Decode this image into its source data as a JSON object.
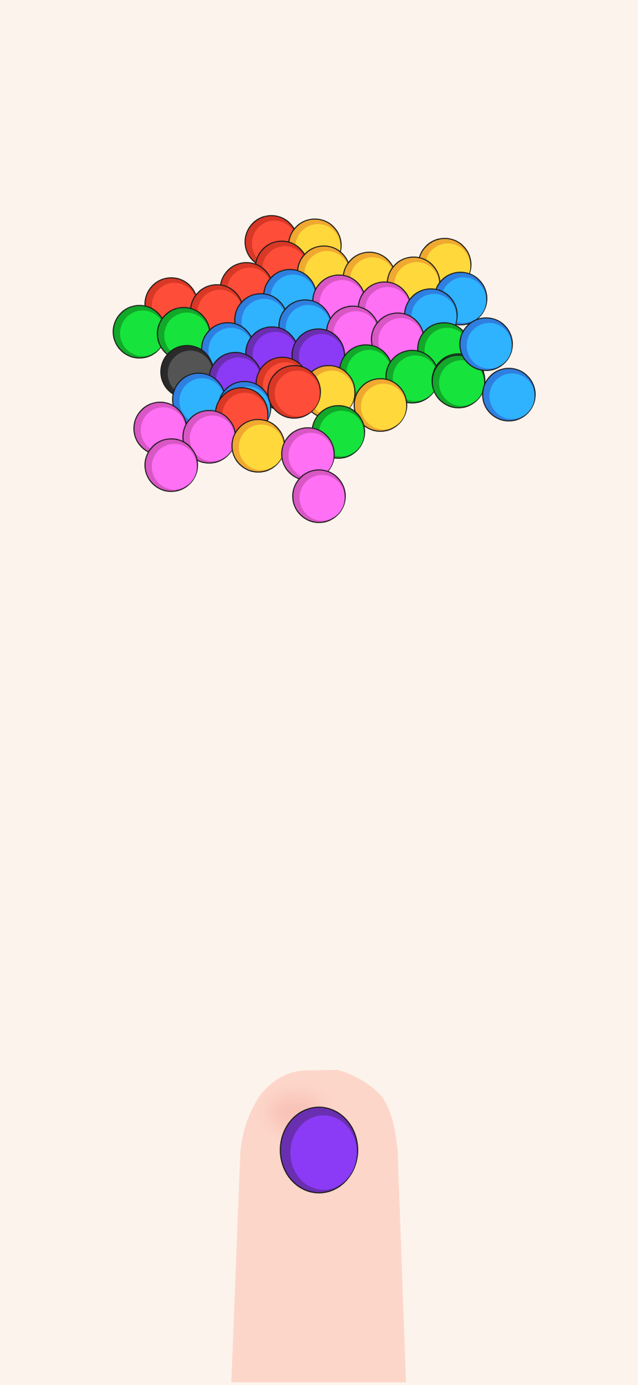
{
  "colors": {
    "background": "#fcf4ec",
    "finger": "#fdd6ca",
    "finger_blush": "#f5b3a8",
    "outline": "#1a1a1a"
  },
  "palette": {
    "red": {
      "base": "#fe4e3a",
      "shade": "#d93826"
    },
    "yellow": {
      "base": "#ffd93b",
      "shade": "#f0a930"
    },
    "blue": {
      "base": "#2fb3ff",
      "shade": "#2f7fe0"
    },
    "pink": {
      "base": "#ff70f5",
      "shade": "#d857c4"
    },
    "green": {
      "base": "#17e33d",
      "shade": "#12a82a"
    },
    "purple": {
      "base": "#8b3bf5",
      "shade": "#6a2fb0"
    },
    "black": {
      "base": "#545454",
      "shade": "#2a2a2a"
    }
  },
  "cluster": {
    "ball_count": 47,
    "balls": [
      "red",
      "yellow",
      "yellow",
      "red",
      "yellow",
      "yellow",
      "yellow",
      "red",
      "red",
      "blue",
      "pink",
      "pink",
      "blue",
      "red",
      "blue",
      "green",
      "green",
      "blue",
      "blue",
      "pink",
      "pink",
      "green",
      "blue",
      "purple",
      "purple",
      "black",
      "green",
      "green",
      "purple",
      "red",
      "green",
      "blue",
      "blue",
      "green",
      "yellow",
      "yellow",
      "red",
      "red",
      "green",
      "pink",
      "pink",
      "yellow",
      "pink",
      "pink",
      "pink",
      "blue",
      "blue"
    ]
  },
  "shooter": {
    "ball_color": "purple"
  }
}
